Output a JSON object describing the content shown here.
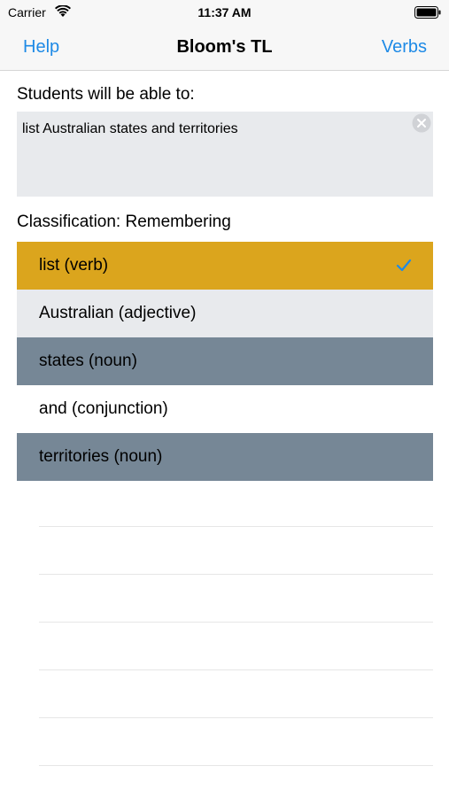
{
  "status_bar": {
    "carrier": "Carrier",
    "time": "11:37 AM"
  },
  "nav": {
    "left": "Help",
    "title": "Bloom's TL",
    "right": "Verbs"
  },
  "prompt_label": "Students will be able to:",
  "objective_text": "list Australian states and territories",
  "classification": "Classification: Remembering",
  "words": [
    {
      "label": "list (verb)",
      "color": "#dba51d",
      "checked": true
    },
    {
      "label": "Australian (adjective)",
      "color": "#e8eaed",
      "checked": false
    },
    {
      "label": "states (noun)",
      "color": "#768796",
      "checked": false
    },
    {
      "label": "and (conjunction)",
      "color": "#ffffff",
      "checked": false
    },
    {
      "label": "territories (noun)",
      "color": "#768796",
      "checked": false
    }
  ],
  "colors": {
    "accent": "#1e8ae6",
    "verb": "#dba51d",
    "noun": "#768796",
    "adjective": "#e8eaed"
  }
}
